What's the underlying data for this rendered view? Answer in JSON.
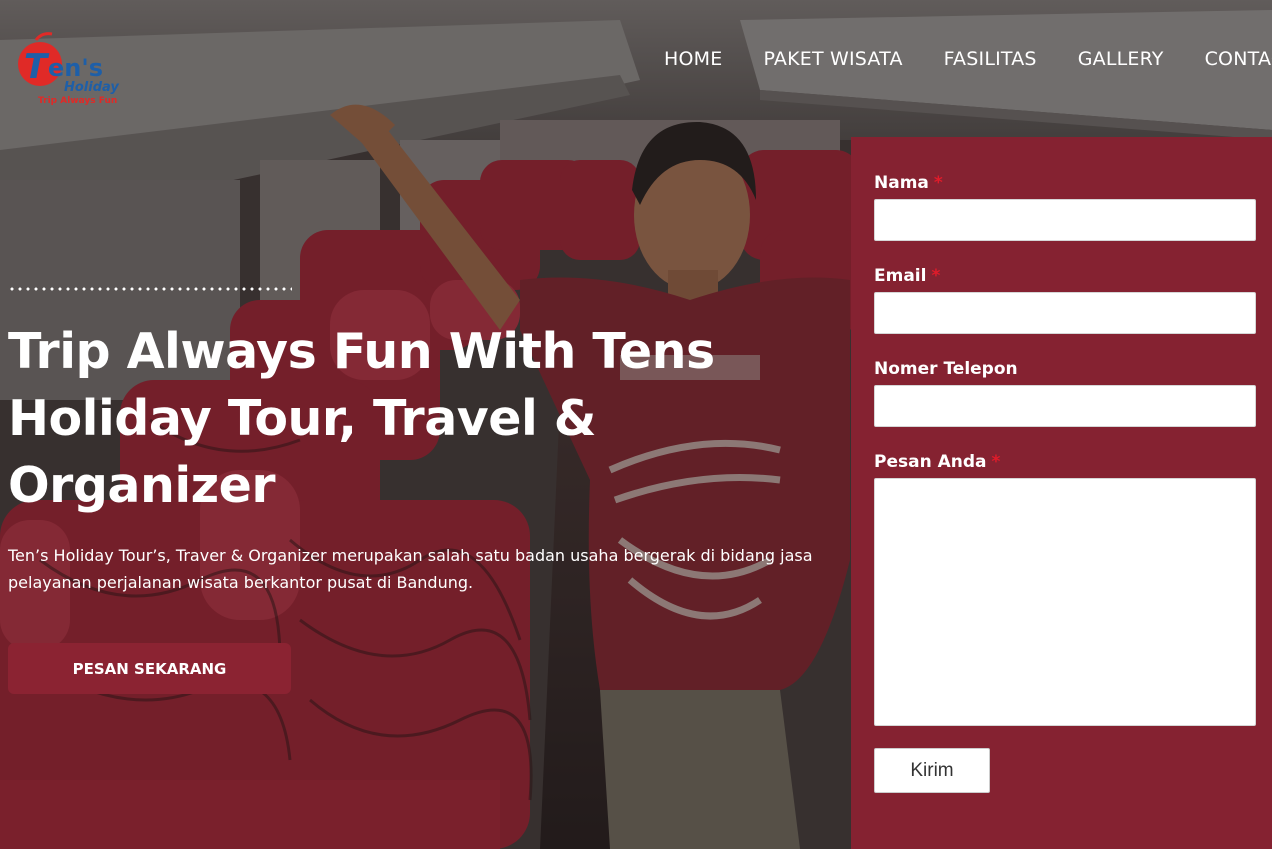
{
  "brand": {
    "logo_name": "Ten's",
    "logo_sub": "Holiday",
    "logo_tagline": "Trip Always Fun",
    "primary_color": "#852231",
    "logo_red": "#e02a27",
    "logo_blue": "#1e5fa8"
  },
  "nav": {
    "items": [
      "HOME",
      "PAKET WISATA",
      "FASILITAS",
      "GALLERY",
      "CONTACT"
    ]
  },
  "hero": {
    "title": "Trip Always Fun With Tens Holiday Tour, Travel & Organizer",
    "description": "Ten’s Holiday Tour’s, Traver & Organizer merupakan salah satu badan usaha bergerak di bidang jasa pelayanan perjalanan wisata berkantor pusat di Bandung.",
    "cta_label": "PESAN SEKARANG"
  },
  "form": {
    "fields": [
      {
        "label": "Nama",
        "required": true,
        "value": ""
      },
      {
        "label": "Email",
        "required": true,
        "value": ""
      },
      {
        "label": "Nomer Telepon",
        "required": false,
        "value": ""
      },
      {
        "label": "Pesan Anda",
        "required": true,
        "value": ""
      }
    ],
    "required_mark": "*",
    "submit_label": "Kirim"
  }
}
